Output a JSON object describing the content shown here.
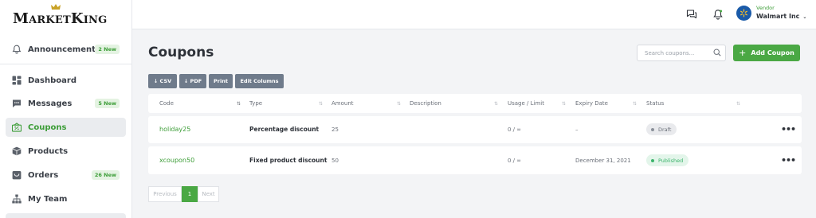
{
  "brand": {
    "logo_letter_m": "M",
    "logo_arket": "ARKET",
    "logo_letter_k": "K",
    "logo_ing": "ING"
  },
  "sidebar": {
    "items": [
      {
        "label": "Announcements",
        "badge": "2 New",
        "icon": "bell-icon"
      },
      {
        "label": "Dashboard",
        "badge": "",
        "icon": "dashboard-grid-icon"
      },
      {
        "label": "Messages",
        "badge": "5 New",
        "icon": "chat-icon"
      },
      {
        "label": "Coupons",
        "badge": "",
        "icon": "coupon-icon",
        "active": true
      },
      {
        "label": "Products",
        "badge": "",
        "icon": "box-icon"
      },
      {
        "label": "Orders",
        "badge": "26 New",
        "icon": "orders-icon"
      },
      {
        "label": "My Team",
        "badge": "",
        "icon": "team-icon"
      }
    ]
  },
  "topbar": {
    "vendor_role": "Vendor",
    "vendor_name": "Walmart Inc"
  },
  "page": {
    "title": "Coupons",
    "search_placeholder": "Search coupons...",
    "add_label": "Add Coupon",
    "export": [
      "↓ CSV",
      "↓ PDF",
      "Print",
      "Edit Columns"
    ]
  },
  "table": {
    "columns": [
      "Code",
      "Type",
      "Amount",
      "Description",
      "Usage / Limit",
      "Expiry Date",
      "Status"
    ],
    "rows": [
      {
        "code": "holiday25",
        "type": "Percentage discount",
        "amount": "25",
        "description": "",
        "usage": "0 / ∞",
        "expiry": "–",
        "status": "Draft"
      },
      {
        "code": "xcoupon50",
        "type": "Fixed product discount",
        "amount": "50",
        "description": "",
        "usage": "0 / ∞",
        "expiry": "December 31, 2021",
        "status": "Published"
      }
    ],
    "actions_label": "•••"
  },
  "pagination": {
    "previous": "Previous",
    "current": "1",
    "next": "Next"
  },
  "colors": {
    "accent": "#4aa844",
    "draft_bg": "#e9eaed",
    "published_bg": "#e3f5ea",
    "published_text": "#3bb46b"
  }
}
